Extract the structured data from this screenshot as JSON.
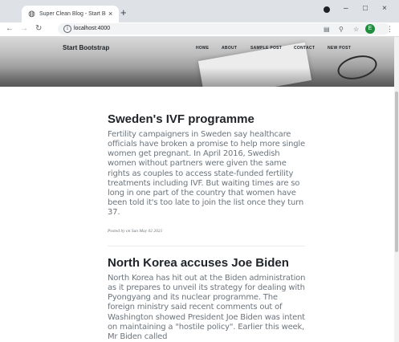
{
  "browser": {
    "tab_title": "Super Clean Blog - Start Bootst",
    "tab_close": "×",
    "new_tab": "+",
    "url": "localhost:4000",
    "profile_initial": "E",
    "window_minimize": "–",
    "window_restore": "□",
    "window_close": "×"
  },
  "site": {
    "brand": "Start Bootstrap",
    "nav": [
      "HOME",
      "ABOUT",
      "SAMPLE POST",
      "CONTACT",
      "NEW POST"
    ]
  },
  "posts": [
    {
      "title": "Sweden's IVF programme",
      "body": "Fertility campaigners in Sweden say healthcare officials have broken a promise to help more single women get pregnant. In April 2016, Swedish women without partners were given the same rights as couples to access state-funded fertility treatments including IVF. But waiting times are so long in one part of the country that women have been told it's too late to join the list once they turn 37.",
      "meta": "Posted by on Sun May 02 2021"
    },
    {
      "title": "North Korea accuses Joe Biden",
      "body": "North Korea has hit out at the Biden administration as it prepares to unveil its strategy for dealing with Pyongyang and its nuclear programme. The foreign ministry said recent comments out of Washington showed President Joe Biden was intent on maintaining a \"hostile policy\". Earlier this week, Mr Biden called",
      "meta": ""
    }
  ],
  "colors": {
    "heading": "#212529",
    "body_text": "#6c757d",
    "tabstrip": "#dee1e6"
  }
}
